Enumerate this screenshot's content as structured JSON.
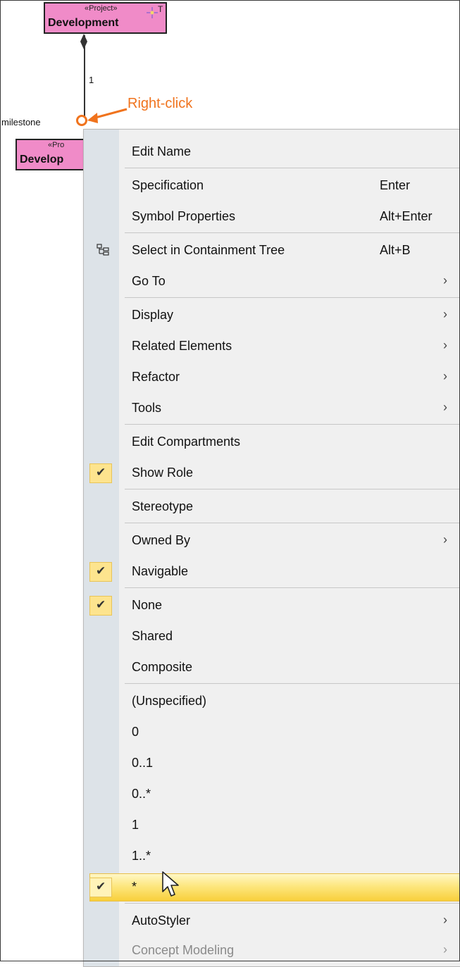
{
  "diagram": {
    "top_class": {
      "stereotype": "«Project»",
      "name": "Development",
      "corner_icon_text": "T"
    },
    "bottom_class": {
      "stereotype": "«Pro",
      "name": "Develop"
    },
    "multiplicity": "1",
    "role_label": "milestone",
    "annotation": "Right-click"
  },
  "menu": {
    "items": [
      {
        "label": "Edit Name",
        "shortcut": "",
        "submenu": false
      },
      {
        "label": "Specification",
        "shortcut": "Enter",
        "submenu": false
      },
      {
        "label": "Symbol Properties",
        "shortcut": "Alt+Enter",
        "submenu": false
      },
      {
        "label": "Select in Containment Tree",
        "shortcut": "Alt+B",
        "submenu": false,
        "icon": "containment-tree-icon"
      },
      {
        "label": "Go To",
        "shortcut": "",
        "submenu": true
      },
      {
        "label": "Display",
        "shortcut": "",
        "submenu": true
      },
      {
        "label": "Related Elements",
        "shortcut": "",
        "submenu": true
      },
      {
        "label": "Refactor",
        "shortcut": "",
        "submenu": true
      },
      {
        "label": "Tools",
        "shortcut": "",
        "submenu": true
      },
      {
        "label": "Edit Compartments",
        "shortcut": "",
        "submenu": false
      },
      {
        "label": "Show Role",
        "shortcut": "",
        "submenu": false,
        "checked": true
      },
      {
        "label": "Stereotype",
        "shortcut": "",
        "submenu": false
      },
      {
        "label": "Owned By",
        "shortcut": "",
        "submenu": true
      },
      {
        "label": "Navigable",
        "shortcut": "",
        "submenu": false,
        "checked": true
      },
      {
        "label": "None",
        "shortcut": "",
        "submenu": false,
        "checked": true
      },
      {
        "label": "Shared",
        "shortcut": "",
        "submenu": false
      },
      {
        "label": "Composite",
        "shortcut": "",
        "submenu": false
      },
      {
        "label": "(Unspecified)",
        "shortcut": "",
        "submenu": false
      },
      {
        "label": "0",
        "shortcut": "",
        "submenu": false
      },
      {
        "label": "0..1",
        "shortcut": "",
        "submenu": false
      },
      {
        "label": "0..*",
        "shortcut": "",
        "submenu": false
      },
      {
        "label": "1",
        "shortcut": "",
        "submenu": false
      },
      {
        "label": "1..*",
        "shortcut": "",
        "submenu": false
      },
      {
        "label": "*",
        "shortcut": "",
        "submenu": false,
        "checked": true,
        "highlighted": true
      },
      {
        "label": "AutoStyler",
        "shortcut": "",
        "submenu": true
      },
      {
        "label": "Concept Modeling",
        "shortcut": "",
        "submenu": true,
        "disabled": true
      }
    ],
    "submenu_glyph": "›",
    "check_glyph": "✔"
  },
  "colors": {
    "class_fill": "#f08bc8",
    "annotation": "#f0731d",
    "check_bg": "#fde48e",
    "highlight": "#f8cf3b"
  }
}
